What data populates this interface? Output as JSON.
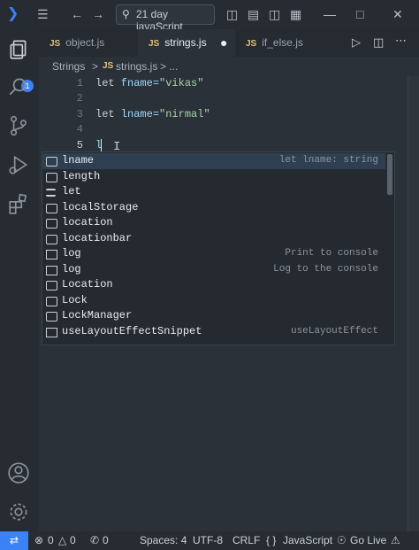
{
  "titlebar": {
    "search_label": "21 day javaScript"
  },
  "activitybar": {
    "explorer_badge": "1"
  },
  "tabs": [
    {
      "label": "object.js",
      "icon": "JS"
    },
    {
      "label": "strings.js",
      "icon": "JS"
    },
    {
      "label": "if_else.js",
      "icon": "JS"
    }
  ],
  "breadcrumb": {
    "folder": "Strings",
    "sep": ">",
    "file_icon": "JS",
    "file": "strings.js",
    "more": "> ..."
  },
  "editor": {
    "lines": [
      {
        "num": "1",
        "kw": "let",
        "name": " fname=",
        "str": "\"vikas\""
      },
      {
        "num": "2",
        "kw": "",
        "name": "",
        "str": ""
      },
      {
        "num": "3",
        "kw": "let",
        "name": " lname=",
        "str": "\"nirmal\""
      },
      {
        "num": "4",
        "kw": "",
        "name": "",
        "str": ""
      },
      {
        "num": "5",
        "kw": "",
        "name": "l",
        "str": ""
      }
    ]
  },
  "suggestions": [
    {
      "label": "lname",
      "detail": "let lname: string",
      "kind": "variable"
    },
    {
      "label": "length",
      "detail": "",
      "kind": "variable"
    },
    {
      "label": "let",
      "detail": "",
      "kind": "keyword"
    },
    {
      "label": "localStorage",
      "detail": "",
      "kind": "variable"
    },
    {
      "label": "location",
      "detail": "",
      "kind": "variable"
    },
    {
      "label": "locationbar",
      "detail": "",
      "kind": "variable"
    },
    {
      "label": "log",
      "detail": "Print to console",
      "kind": "snippet"
    },
    {
      "label": "log",
      "detail": "Log to the console",
      "kind": "snippet"
    },
    {
      "label": "Location",
      "detail": "",
      "kind": "variable"
    },
    {
      "label": "Lock",
      "detail": "",
      "kind": "variable"
    },
    {
      "label": "LockManager",
      "detail": "",
      "kind": "variable"
    },
    {
      "label": "useLayoutEffectSnippet",
      "detail": "useLayoutEffect",
      "kind": "snippet"
    }
  ],
  "statusbar": {
    "errors": "0",
    "warnings": "0",
    "ports": "0",
    "spaces": "Spaces: 4",
    "encoding": "UTF-8",
    "eol": "CRLF",
    "language": "JavaScript",
    "golive": "Go Live"
  },
  "colors": {
    "accent": "#3b82f6",
    "string": "#a5d6a7",
    "js_icon": "#e5c07b"
  }
}
